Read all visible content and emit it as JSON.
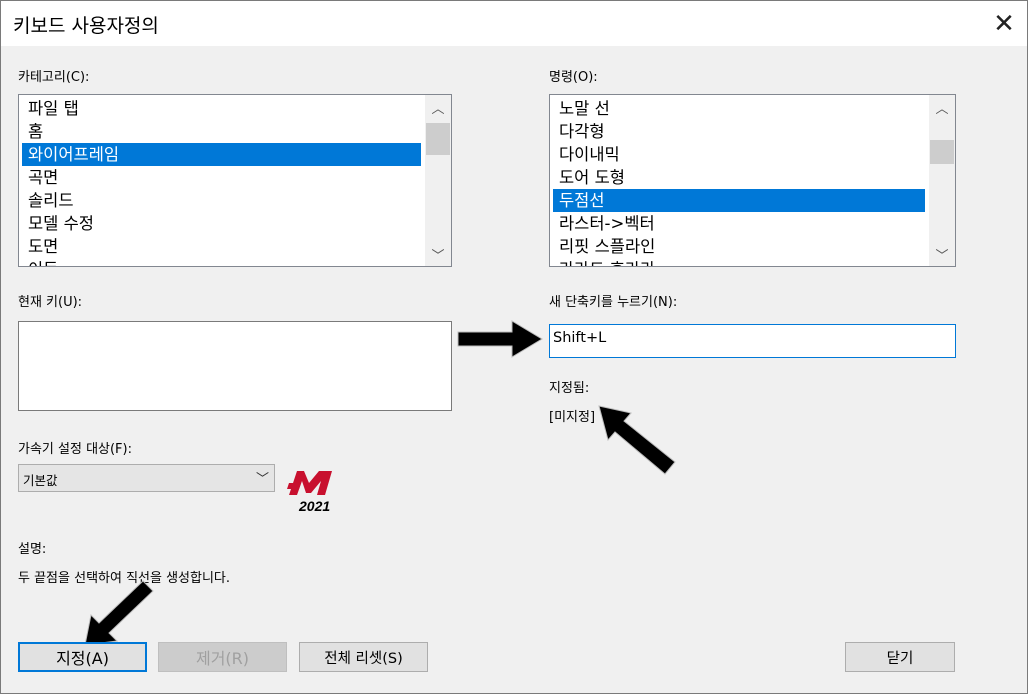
{
  "window": {
    "title": "키보드 사용자정의",
    "close_icon": "close-icon"
  },
  "category": {
    "label": "카테고리(C):",
    "items": [
      "파일 탭",
      "홈",
      "와이어프레임",
      "곡면",
      "솔리드",
      "모델 수정",
      "도면",
      "이동"
    ],
    "selected": "와이어프레임"
  },
  "commands": {
    "label": "명령(O):",
    "items": [
      "노말 선",
      "다각형",
      "다이내믹",
      "도어 도형",
      "두점선",
      "라스터->벡터",
      "리핏 스플라인",
      "라라드 후라라"
    ],
    "selected": "두점선"
  },
  "current_key": {
    "label": "현재 키(U):",
    "value": ""
  },
  "new_shortcut": {
    "label": "새 단축키를 누르기(N):",
    "value": "Shift+L"
  },
  "assigned": {
    "label": "지정됨:",
    "value": "[미지정]"
  },
  "accelerator": {
    "label": "가속기 설정 대상(F):",
    "value": "기본값"
  },
  "logo": {
    "year": "2021",
    "accent": "#c8102e"
  },
  "description": {
    "label": "설명:",
    "text": "두 끝점을 선택하여 직선을 생성합니다."
  },
  "buttons": {
    "assign": "지정(A)",
    "remove": "제거(R)",
    "reset_all": "전체 리셋(S)",
    "close": "닫기"
  },
  "colors": {
    "selection": "#0078d7",
    "background": "#f0f0f0"
  }
}
